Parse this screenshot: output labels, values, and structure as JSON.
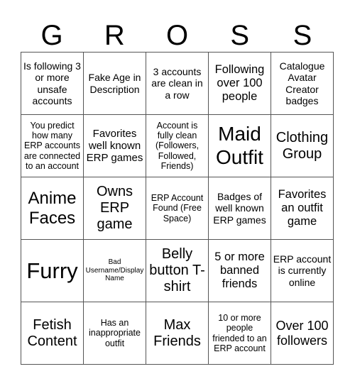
{
  "title_letters": [
    "G",
    "R",
    "O",
    "S",
    "S"
  ],
  "cells": [
    [
      "Is following 3 or more unsafe accounts",
      "Fake Age in Description",
      "3 accounts are clean in a row",
      "Following over 100 people",
      "Catalogue Avatar Creator badges"
    ],
    [
      "You predict how many ERP accounts are connected to an account",
      "Favorites well known ERP games",
      "Account is fully clean (Followers, Followed, Friends)",
      "Maid Outfit",
      "Clothing Group"
    ],
    [
      "Anime Faces",
      "Owns ERP game",
      "ERP Account Found (Free Space)",
      "Badges of well known ERP games",
      "Favorites an outfit game"
    ],
    [
      "Furry",
      "Bad Username/Display Name",
      "Belly button T-shirt",
      "5 or more banned friends",
      "ERP account is currently online"
    ],
    [
      "Fetish Content",
      "Has an inappropriate outfit",
      "Max Friends",
      "10 or more people friended to an ERP account",
      "Over 100 followers"
    ]
  ]
}
